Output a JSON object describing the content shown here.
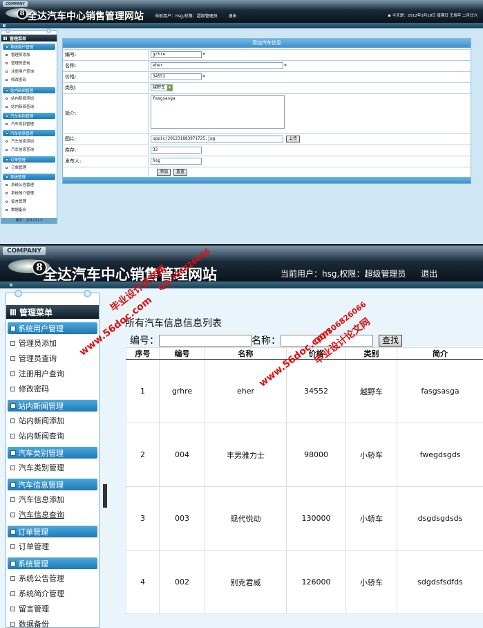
{
  "header": {
    "company": "COMPANY",
    "logo_mark": "8",
    "site_title": "全达汽车中心销售管理网站",
    "user_prefix": "当前用户：",
    "user_name": "hsg",
    "role_prefix": ",权限：",
    "role": "超级管理员",
    "logout": "退出",
    "date_text": "今天是：2012年3月18日  星期日  壬辰年  二月廿六"
  },
  "sidebar": {
    "title": "管理菜单",
    "version": "版本：2012V1.0",
    "groups": [
      {
        "label": "系统用户管理",
        "items": [
          "管理员添加",
          "管理员查询",
          "注册用户查询",
          "修改密码"
        ]
      },
      {
        "label": "站内新闻管理",
        "items": [
          "站内新闻添加",
          "站内新闻查询"
        ]
      },
      {
        "label": "汽车类别管理",
        "items": [
          "汽车类别管理"
        ]
      },
      {
        "label": "汽车信息管理",
        "items": [
          "汽车信息添加",
          "汽车信息查询"
        ]
      },
      {
        "label": "订单管理",
        "items": [
          "订单管理"
        ]
      },
      {
        "label": "系统管理",
        "items": [
          "系统公告管理",
          "系统简介管理",
          "留言管理",
          "数据备份"
        ]
      }
    ]
  },
  "add_form": {
    "title": "添加汽车信息",
    "fields": {
      "code": {
        "label": "编号:",
        "value": "grhre"
      },
      "name": {
        "label": "名称:",
        "value": "eher"
      },
      "price": {
        "label": "价格:",
        "value": "34552"
      },
      "type": {
        "label": "类别:",
        "value": "越野车"
      },
      "intro": {
        "label": "简介:",
        "value": "fasgsasga"
      },
      "image": {
        "label": "图片:",
        "value": "uppic/201231883971725.jpg"
      },
      "stock": {
        "label": "库存:",
        "value": "32"
      },
      "publisher": {
        "label": "发布人:",
        "value": "hsg"
      }
    },
    "required_mark": "*",
    "upload_button": "上传",
    "add_button": "添加",
    "reset_button": "重置"
  },
  "list": {
    "title": "所有汽车信息信息列表",
    "search": {
      "code_label": "编号：",
      "name_label": "名称：",
      "button": "查找"
    },
    "columns": [
      "序号",
      "编号",
      "名称",
      "价格",
      "类别",
      "简介"
    ],
    "rows": [
      [
        "1",
        "grhre",
        "eher",
        "34552",
        "越野车",
        "fasgsasga"
      ],
      [
        "2",
        "004",
        "丰男雅力士",
        "98000",
        "小轿车",
        "fwegdsgds"
      ],
      [
        "3",
        "003",
        "现代悦动",
        "130000",
        "小轿车",
        "dsgdsgdsds"
      ],
      [
        "4",
        "002",
        "别克君威",
        "126000",
        "小轿车",
        "sdgdsfsdfds"
      ]
    ]
  },
  "watermarks": [
    "www.56doc.com",
    "毕业设计论文网",
    "QQ:306826066",
    "www.56doc.com",
    "QQ:306826066",
    "毕业设计论文网"
  ],
  "colors": {
    "header_dark": "#0b141c",
    "menu_group": "#1f78b4",
    "panel_title": "#3d8fca",
    "watermark": "#e01010"
  }
}
